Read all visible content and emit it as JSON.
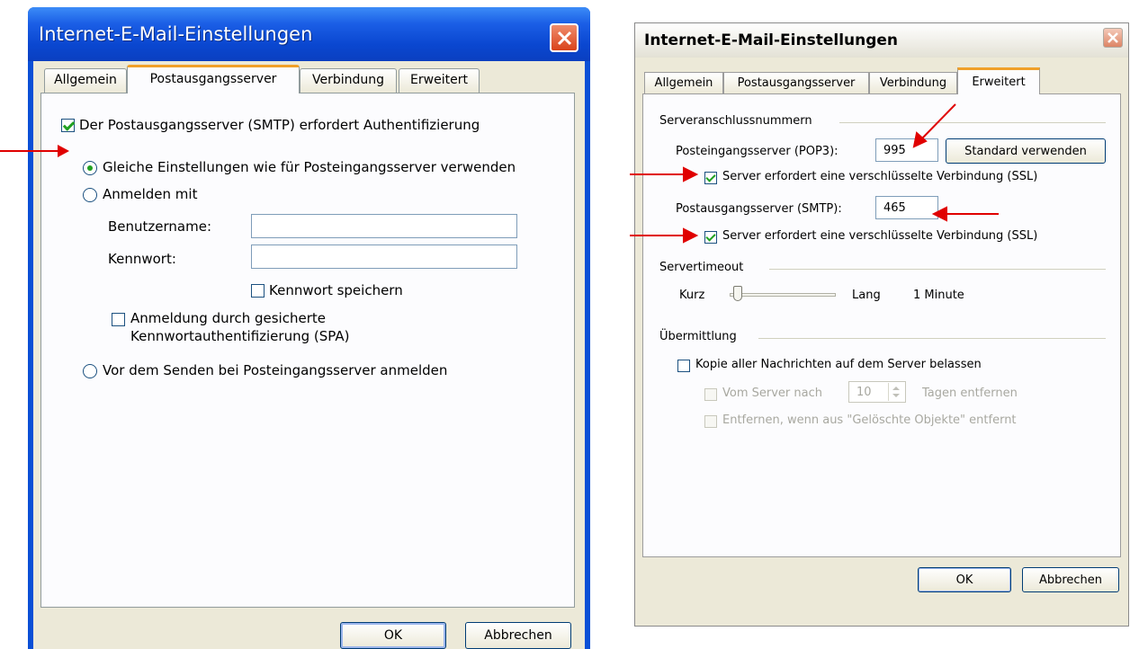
{
  "window_left": {
    "title": "Internet-E-Mail-Einstellungen",
    "tabs": [
      "Allgemein",
      "Postausgangsserver",
      "Verbindung",
      "Erweitert"
    ],
    "active_tab": "Postausgangsserver",
    "smtp_auth_label": "Der Postausgangsserver (SMTP) erfordert Authentifizierung",
    "radio_same_label": "Gleiche Einstellungen wie für Posteingangsserver verwenden",
    "radio_login_label": "Anmelden mit",
    "username_label": "Benutzername:",
    "username_value": "",
    "password_label": "Kennwort:",
    "password_value": "",
    "save_password_label": "Kennwort speichern",
    "spa_label_line1": "Anmeldung durch gesicherte",
    "spa_label_line2": "Kennwortauthentifizierung (SPA)",
    "radio_before_send_label": "Vor dem Senden bei Posteingangsserver anmelden",
    "ok_label": "OK",
    "cancel_label": "Abbrechen"
  },
  "window_right": {
    "title": "Internet-E-Mail-Einstellungen",
    "tabs": [
      "Allgemein",
      "Postausgangsserver",
      "Verbindung",
      "Erweitert"
    ],
    "active_tab": "Erweitert",
    "group_ports": "Serveranschlussnummern",
    "pop3_label": "Posteingangsserver (POP3):",
    "pop3_value": "995",
    "default_button": "Standard verwenden",
    "ssl_incoming_label": "Server erfordert eine verschlüsselte Verbindung (SSL)",
    "smtp_label": "Postausgangsserver (SMTP):",
    "smtp_value": "465",
    "ssl_outgoing_label": "Server erfordert eine verschlüsselte Verbindung (SSL)",
    "group_timeout": "Servertimeout",
    "timeout_short": "Kurz",
    "timeout_long": "Lang",
    "timeout_value": "1 Minute",
    "timeout_slider_fraction": 0.0,
    "group_delivery": "Übermittlung",
    "keep_copy_label": "Kopie aller Nachrichten auf dem Server belassen",
    "remove_after_label": "Vom Server nach",
    "remove_after_days": "10",
    "days_suffix": "Tagen entfernen",
    "remove_deleted_label": "Entfernen, wenn aus \"Gelöschte Objekte\" entfernt",
    "ok_label": "OK",
    "cancel_label": "Abbrechen"
  },
  "annotation_color": "#e00000",
  "accent_tab_color": "#f0a02a"
}
